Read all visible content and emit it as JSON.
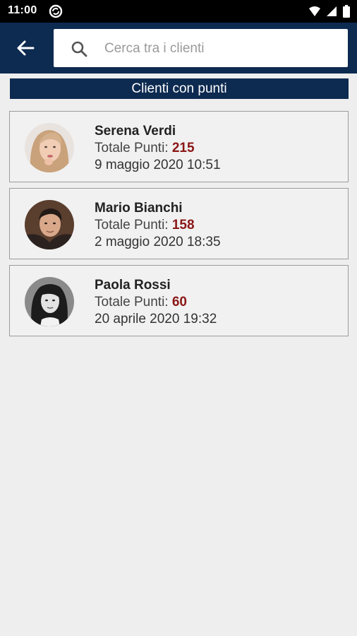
{
  "status_bar": {
    "time": "11:00",
    "app_icon": "at-sync-icon",
    "icons": [
      "wifi-icon",
      "signal-icon",
      "battery-icon"
    ]
  },
  "app_bar": {
    "back_icon": "arrow-left-icon",
    "search": {
      "placeholder": "Cerca tra i clienti",
      "value": ""
    }
  },
  "section": {
    "title": "Clienti con punti"
  },
  "points_label": "Totale Punti: ",
  "clients": [
    {
      "name": "Serena Verdi",
      "points": "215",
      "date": "9 maggio 2020 10:51"
    },
    {
      "name": "Mario Bianchi",
      "points": "158",
      "date": "2 maggio 2020 18:35"
    },
    {
      "name": "Paola Rossi",
      "points": "60",
      "date": "20 aprile 2020 19:32"
    }
  ],
  "colors": {
    "primary": "#0d2a50",
    "points": "#8b1616",
    "background": "#eeeeee"
  }
}
